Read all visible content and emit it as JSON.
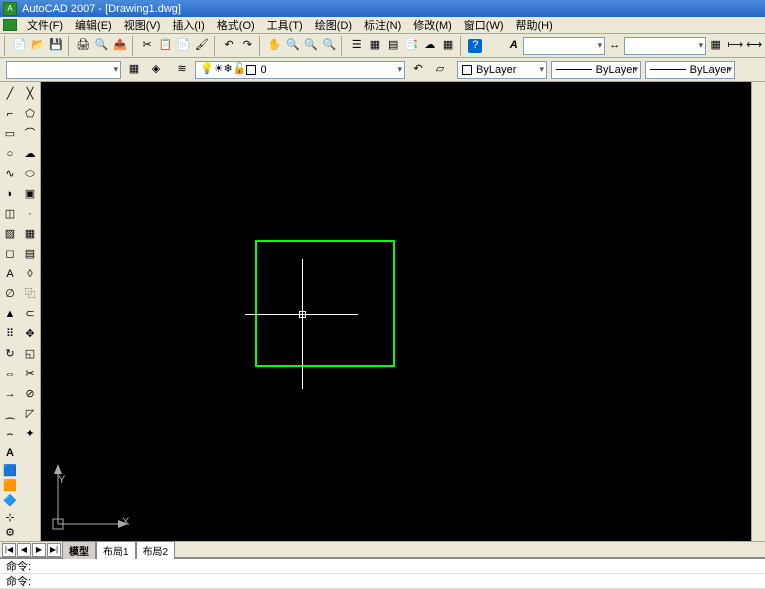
{
  "title": "AutoCAD 2007 - [Drawing1.dwg]",
  "menu": {
    "file": "文件(F)",
    "edit": "编辑(E)",
    "view": "视图(V)",
    "insert": "插入(I)",
    "format": "格式(O)",
    "tools": "工具(T)",
    "draw": "绘图(D)",
    "dim": "标注(N)",
    "modify": "修改(M)",
    "window": "窗口(W)",
    "help": "帮助(H)"
  },
  "layer": {
    "current_display": "0",
    "bulbs": "💡☀❄🔓"
  },
  "props": {
    "color": "ByLayer",
    "linetype": "ByLayer",
    "lineweight": "ByLayer"
  },
  "tabs": {
    "model": "模型",
    "layout1": "布局1",
    "layout2": "布局2"
  },
  "cmd": {
    "line1": "命令:",
    "line2": "命令:"
  },
  "ucs": {
    "x": "X",
    "y": "Y"
  },
  "nav": {
    "first": "|◀",
    "prev": "◀",
    "next": "▶",
    "last": "▶|"
  },
  "styleplaceholder": "A",
  "a_annotate": "A"
}
